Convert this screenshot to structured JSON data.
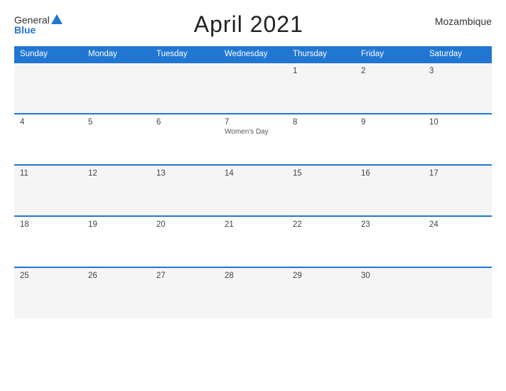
{
  "header": {
    "logo_general": "General",
    "logo_blue": "Blue",
    "title": "April 2021",
    "country": "Mozambique"
  },
  "calendar": {
    "weekdays": [
      "Sunday",
      "Monday",
      "Tuesday",
      "Wednesday",
      "Thursday",
      "Friday",
      "Saturday"
    ],
    "rows": [
      [
        {
          "day": "",
          "holiday": ""
        },
        {
          "day": "",
          "holiday": ""
        },
        {
          "day": "",
          "holiday": ""
        },
        {
          "day": "",
          "holiday": ""
        },
        {
          "day": "1",
          "holiday": ""
        },
        {
          "day": "2",
          "holiday": ""
        },
        {
          "day": "3",
          "holiday": ""
        }
      ],
      [
        {
          "day": "4",
          "holiday": ""
        },
        {
          "day": "5",
          "holiday": ""
        },
        {
          "day": "6",
          "holiday": ""
        },
        {
          "day": "7",
          "holiday": "Women's Day"
        },
        {
          "day": "8",
          "holiday": ""
        },
        {
          "day": "9",
          "holiday": ""
        },
        {
          "day": "10",
          "holiday": ""
        }
      ],
      [
        {
          "day": "11",
          "holiday": ""
        },
        {
          "day": "12",
          "holiday": ""
        },
        {
          "day": "13",
          "holiday": ""
        },
        {
          "day": "14",
          "holiday": ""
        },
        {
          "day": "15",
          "holiday": ""
        },
        {
          "day": "16",
          "holiday": ""
        },
        {
          "day": "17",
          "holiday": ""
        }
      ],
      [
        {
          "day": "18",
          "holiday": ""
        },
        {
          "day": "19",
          "holiday": ""
        },
        {
          "day": "20",
          "holiday": ""
        },
        {
          "day": "21",
          "holiday": ""
        },
        {
          "day": "22",
          "holiday": ""
        },
        {
          "day": "23",
          "holiday": ""
        },
        {
          "day": "24",
          "holiday": ""
        }
      ],
      [
        {
          "day": "25",
          "holiday": ""
        },
        {
          "day": "26",
          "holiday": ""
        },
        {
          "day": "27",
          "holiday": ""
        },
        {
          "day": "28",
          "holiday": ""
        },
        {
          "day": "29",
          "holiday": ""
        },
        {
          "day": "30",
          "holiday": ""
        },
        {
          "day": "",
          "holiday": ""
        }
      ]
    ]
  }
}
